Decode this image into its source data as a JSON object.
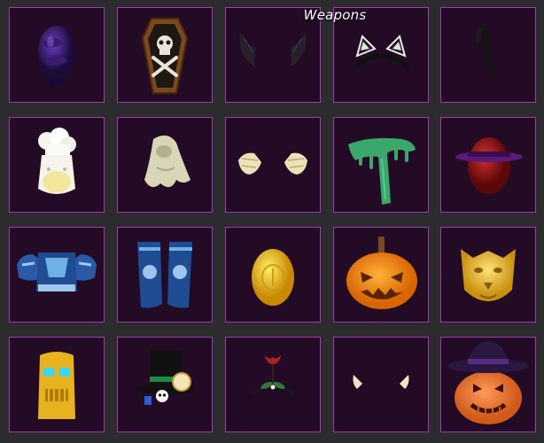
{
  "title": "Weapons",
  "colors": {
    "background": "#2c2b2e",
    "slot_fill": "#230b26",
    "slot_border": "#a03bb0"
  },
  "items": [
    {
      "id": "shadow-egg",
      "icon": "purple-egg-icon"
    },
    {
      "id": "coffin-skull",
      "icon": "coffin-icon"
    },
    {
      "id": "bat-wings",
      "icon": "bat-wings-icon"
    },
    {
      "id": "cat-ears",
      "icon": "cat-ears-headband-icon"
    },
    {
      "id": "black-stick",
      "icon": "black-stick-icon"
    },
    {
      "id": "chef-outfit",
      "icon": "chef-hat-icon"
    },
    {
      "id": "ghost-sheet",
      "icon": "ghost-icon"
    },
    {
      "id": "mummy-hands",
      "icon": "mummy-hands-icon"
    },
    {
      "id": "slime-scarf",
      "icon": "slime-scarf-icon"
    },
    {
      "id": "witch-egg",
      "icon": "witch-egg-icon"
    },
    {
      "id": "blue-armor",
      "icon": "armor-chest-icon"
    },
    {
      "id": "blue-boots",
      "icon": "boots-icon"
    },
    {
      "id": "golden-egg",
      "icon": "golden-egg-icon"
    },
    {
      "id": "jack-o-lantern",
      "icon": "pumpkin-icon"
    },
    {
      "id": "golden-lion",
      "icon": "lion-mask-icon"
    },
    {
      "id": "golden-tiki",
      "icon": "tiki-mask-icon"
    },
    {
      "id": "top-hat",
      "icon": "top-hat-icon"
    },
    {
      "id": "mistletoe-headband",
      "icon": "mistletoe-icon"
    },
    {
      "id": "elf-ears",
      "icon": "elf-ears-icon"
    },
    {
      "id": "pumpkin-witch-hat",
      "icon": "pumpkin-hat-icon"
    }
  ]
}
